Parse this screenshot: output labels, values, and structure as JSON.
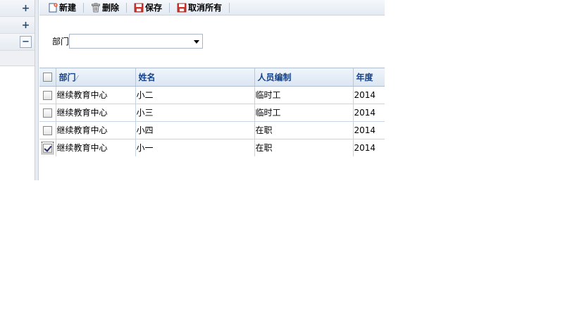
{
  "toolbar": {
    "new_label": "新建",
    "delete_label": "删除",
    "save_label": "保存",
    "cancel_all_label": "取消所有"
  },
  "left_panel": {
    "rows": [
      {
        "toggle": "+"
      },
      {
        "toggle": "+"
      },
      {
        "toggle": "−"
      }
    ]
  },
  "filter": {
    "label": "部门",
    "selected_value": ""
  },
  "grid": {
    "columns": [
      "部门",
      "姓名",
      "人员编制",
      "年度"
    ],
    "sort_indicator": "⁄",
    "rows": [
      {
        "checked": false,
        "dept": "继续教育中心",
        "name": "小二",
        "staffing": "临时工",
        "year": "2014"
      },
      {
        "checked": false,
        "dept": "继续教育中心",
        "name": "小三",
        "staffing": "临时工",
        "year": "2014"
      },
      {
        "checked": false,
        "dept": "继续教育中心",
        "name": "小四",
        "staffing": "在职",
        "year": "2014"
      },
      {
        "checked": true,
        "dept": "继续教育中心",
        "name": "小一",
        "staffing": "在职",
        "year": "2014"
      }
    ]
  },
  "colors": {
    "header_text": "#15428b",
    "grid_border": "#c5d3e3"
  },
  "icons": {
    "new": "new-document-icon",
    "delete": "trash-icon",
    "save": "save-icon",
    "cancel_all": "cancel-save-icon"
  }
}
